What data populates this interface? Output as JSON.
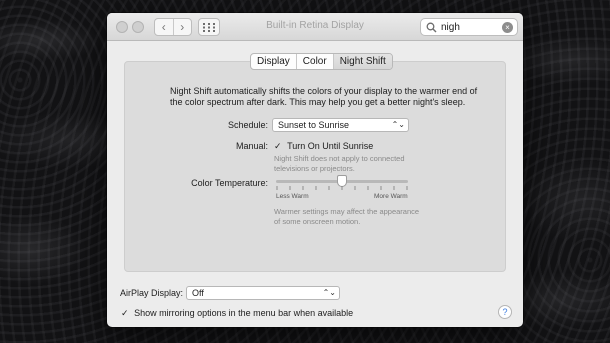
{
  "window": {
    "title": "Built-in Retina Display"
  },
  "toolbar": {
    "back_glyph": "‹",
    "forward_glyph": "›",
    "search": {
      "value": "nigh",
      "clear_glyph": "×"
    }
  },
  "tabs": [
    {
      "label": "Display",
      "selected": false
    },
    {
      "label": "Color",
      "selected": false
    },
    {
      "label": "Night Shift",
      "selected": true
    }
  ],
  "night_shift": {
    "description": "Night Shift automatically shifts the colors of your display to the warmer end of the color spectrum after dark. This may help you get a better night's sleep.",
    "schedule": {
      "label": "Schedule:",
      "value": "Sunset to Sunrise",
      "chevron": "⌃⌄"
    },
    "manual": {
      "label": "Manual:",
      "checkbox_label": "Turn On Until Sunrise",
      "checked": true,
      "check_glyph": "✓",
      "note": "Night Shift does not apply to connected televisions or projectors."
    },
    "color_temperature": {
      "label": "Color Temperature:",
      "min_label": "Less Warm",
      "max_label": "More Warm",
      "value_fraction": 0.5,
      "note": "Warmer settings may affect the appearance of some onscreen motion."
    }
  },
  "airplay": {
    "label": "AirPlay Display:",
    "value": "Off",
    "chevron": "⌃⌄"
  },
  "mirroring": {
    "checked": true,
    "check_glyph": "✓",
    "label": "Show mirroring options in the menu bar when available"
  },
  "help": {
    "glyph": "?"
  },
  "icons": [
    "close-button",
    "minimize-button",
    "zoom-button",
    "back-chevron-icon",
    "forward-chevron-icon",
    "grid-icon",
    "search-icon",
    "clear-icon",
    "help-icon"
  ],
  "colors": {
    "accent": "#3a7be0",
    "window_bg": "#ececec",
    "panel_bg": "#dcdcdc"
  }
}
